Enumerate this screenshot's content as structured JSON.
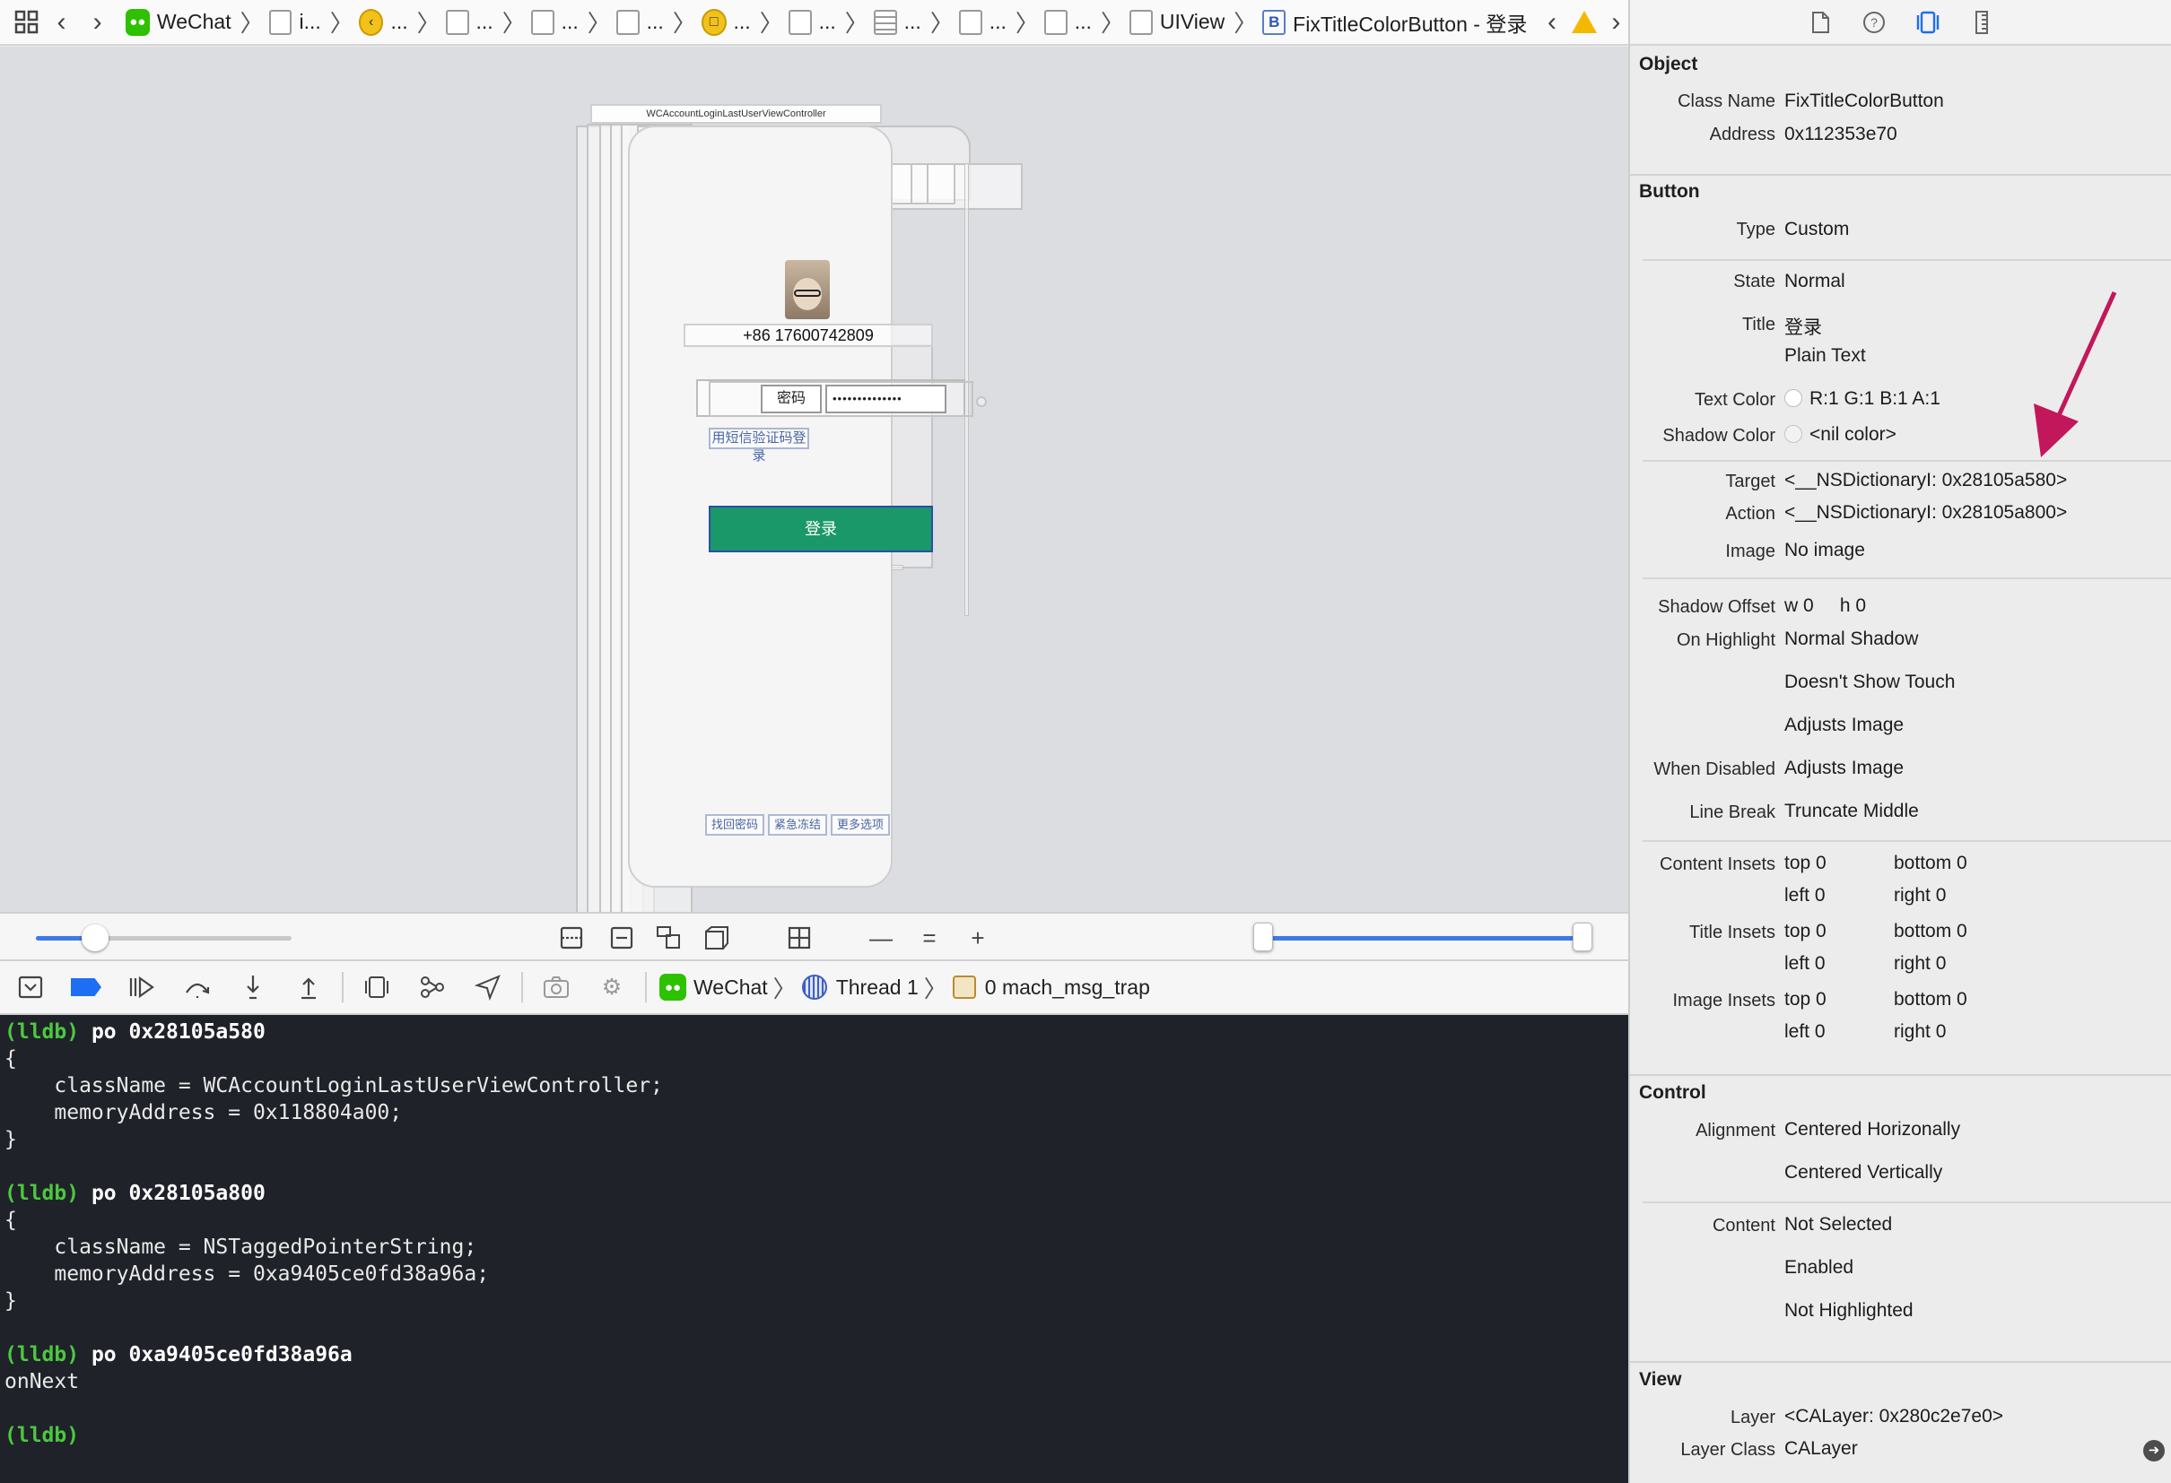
{
  "jumpbar": {
    "wechat": "WeChat",
    "seg_i": "i...",
    "ellipsis": "...",
    "uiview": "UIView",
    "button_path": "FixTitleColorButton - 登录"
  },
  "canvas": {
    "vc_title": "WCAccountLoginLastUserViewController",
    "phone_number": "+86 17600742809",
    "password_label": "密码",
    "password_mask": "••••••••••••••",
    "sms_login": "用短信验证码登录",
    "login_button": "登录",
    "bottom_links": [
      "找回密码",
      "紧急冻结",
      "更多选项"
    ]
  },
  "debug": {
    "app": "WeChat",
    "thread": "Thread 1",
    "frame": "0 mach_msg_trap"
  },
  "console": {
    "prompt": "(lldb)",
    "cmd1": "po 0x28105a580",
    "out1": "{\n    className = WCAccountLoginLastUserViewController;\n    memoryAddress = 0x118804a00;\n}",
    "cmd2": "po 0x28105a800",
    "out2": "{\n    className = NSTaggedPointerString;\n    memoryAddress = 0xa9405ce0fd38a96a;\n}",
    "cmd3": "po 0xa9405ce0fd38a96a",
    "out3": "onNext"
  },
  "inspector": {
    "object": {
      "title": "Object",
      "class_label": "Class Name",
      "class_value": "FixTitleColorButton",
      "address_label": "Address",
      "address_value": "0x112353e70"
    },
    "button": {
      "title": "Button",
      "type_label": "Type",
      "type_value": "Custom",
      "state_label": "State",
      "state_value": "Normal",
      "title_label": "Title",
      "title_value": "登录",
      "title_kind": "Plain Text",
      "text_color_label": "Text Color",
      "text_color_value": "R:1 G:1 B:1 A:1",
      "shadow_color_label": "Shadow Color",
      "shadow_color_value": "<nil color>",
      "target_label": "Target",
      "target_value": "<__NSDictionaryI: 0x28105a580>",
      "action_label": "Action",
      "action_value": "<__NSDictionaryI: 0x28105a800>",
      "image_label": "Image",
      "image_value": "No image",
      "shadow_offset_label": "Shadow Offset",
      "shadow_offset_value": "w 0     h 0",
      "on_highlight_label": "On Highlight",
      "on_highlight_value": "Normal Shadow",
      "touch_value": "Doesn't Show Touch",
      "adjusts_value": "Adjusts Image",
      "when_disabled_label": "When Disabled",
      "when_disabled_value": "Adjusts Image",
      "line_break_label": "Line Break",
      "line_break_value": "Truncate Middle",
      "content_insets_label": "Content Insets",
      "title_insets_label": "Title Insets",
      "image_insets_label": "Image Insets",
      "top": "top",
      "bottom": "bottom",
      "left": "left",
      "right": "right",
      "zero": "0"
    },
    "control": {
      "title": "Control",
      "alignment_label": "Alignment",
      "alignment_h": "Centered Horizonally",
      "alignment_v": "Centered Vertically",
      "content_label": "Content",
      "content_1": "Not Selected",
      "content_2": "Enabled",
      "content_3": "Not Highlighted"
    },
    "view": {
      "title": "View",
      "layer_label": "Layer",
      "layer_value": "<CALayer: 0x280c2e7e0>",
      "layer_class_label": "Layer Class",
      "layer_class_value": "CALayer"
    }
  },
  "colors": {
    "accent": "#1d6ef2",
    "login_green": "#1a9869",
    "arrow": "#c2185b",
    "console_bg": "#1f2229",
    "prompt_green": "#4cc93f"
  }
}
